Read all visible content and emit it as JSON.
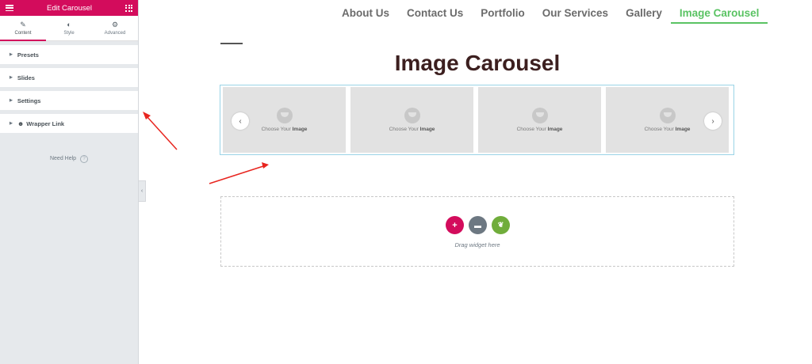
{
  "sidebar": {
    "title": "Edit Carousel",
    "tabs": [
      {
        "label": "Content",
        "icon": "pencil-icon"
      },
      {
        "label": "Style",
        "icon": "half-circle-icon"
      },
      {
        "label": "Advanced",
        "icon": "gear-icon"
      }
    ],
    "sections": [
      {
        "label": "Presets"
      },
      {
        "label": "Slides"
      },
      {
        "label": "Settings"
      },
      {
        "label": "Wrapper Link",
        "icon": "emoji-icon"
      }
    ],
    "need_help": "Need Help",
    "accent_color": "#d30c5c"
  },
  "nav": {
    "items": [
      "About Us",
      "Contact Us",
      "Portfolio",
      "Our Services",
      "Gallery",
      "Image Carousel"
    ],
    "active": "Image Carousel",
    "active_color": "#5ac363"
  },
  "main": {
    "heading": "Image Carousel",
    "slides": [
      {
        "caption_prefix": "Choose Your",
        "caption_bold": "Image"
      },
      {
        "caption_prefix": "Choose Your",
        "caption_bold": "Image"
      },
      {
        "caption_prefix": "Choose Your",
        "caption_bold": "Image"
      },
      {
        "caption_prefix": "Choose Your",
        "caption_bold": "Image"
      }
    ],
    "prev_arrow": "‹",
    "next_arrow": "›",
    "dropzone_text": "Drag widget here",
    "add_symbol": "+",
    "arrow_color": "#e8251f"
  }
}
